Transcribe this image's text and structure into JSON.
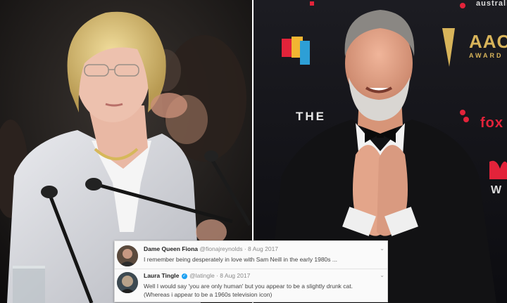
{
  "backdrop": {
    "brand_the": "THE",
    "aacta_letters": "AAC",
    "awards_text": "AWARD",
    "foxtel_text": "fox",
    "australia_text": "australi",
    "w_text": "W"
  },
  "tweets": [
    {
      "name": "Dame Queen Fiona",
      "handle": "@fionajreynolds",
      "date": "· 8 Aug 2017",
      "verified": false,
      "text": "I remember being desperately in love with Sam Neill in the early 1980s ..."
    },
    {
      "name": "Laura Tingle",
      "handle": "@latingle",
      "date": "· 8 Aug 2017",
      "verified": true,
      "verified_icon": "verified-check-icon",
      "text": "Well I would say 'you are only human' but you appear to be a slightly drunk cat. (Whereas i appear to be a 1960s television icon)"
    }
  ],
  "icons": {
    "more": "chevron-down-icon"
  },
  "colors": {
    "backdrop_red": "#e2233a",
    "backdrop_gold": "#d8b45a",
    "verified_blue": "#1da1f2"
  }
}
